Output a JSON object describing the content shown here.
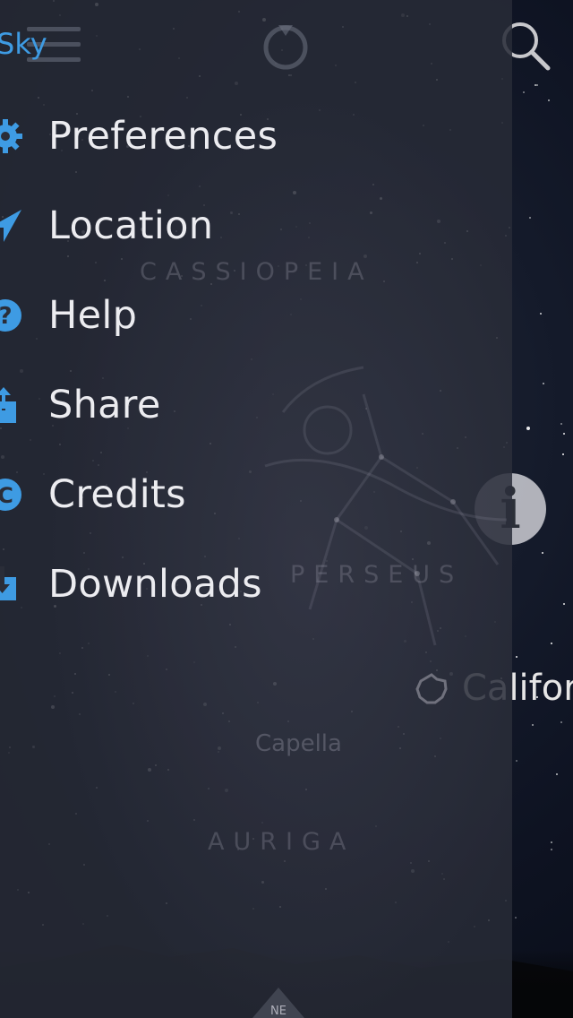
{
  "app": {
    "title": "Sky"
  },
  "menu": {
    "items": [
      {
        "label": "Preferences",
        "icon": "gear-icon"
      },
      {
        "label": "Location",
        "icon": "location-arrow-icon"
      },
      {
        "label": "Help",
        "icon": "help-icon"
      },
      {
        "label": "Share",
        "icon": "share-icon"
      },
      {
        "label": "Credits",
        "icon": "credits-icon"
      },
      {
        "label": "Downloads",
        "icon": "download-icon"
      }
    ]
  },
  "sky": {
    "constellations": [
      "CASSIOPEIA",
      "PERSEUS",
      "AURIGA"
    ],
    "star_label": "Capella",
    "object_label": "California",
    "compass_direction": "NE"
  },
  "colors": {
    "accent": "#3e9be3",
    "menu_text": "#ececf0",
    "drawer_bg": "#282b37"
  }
}
